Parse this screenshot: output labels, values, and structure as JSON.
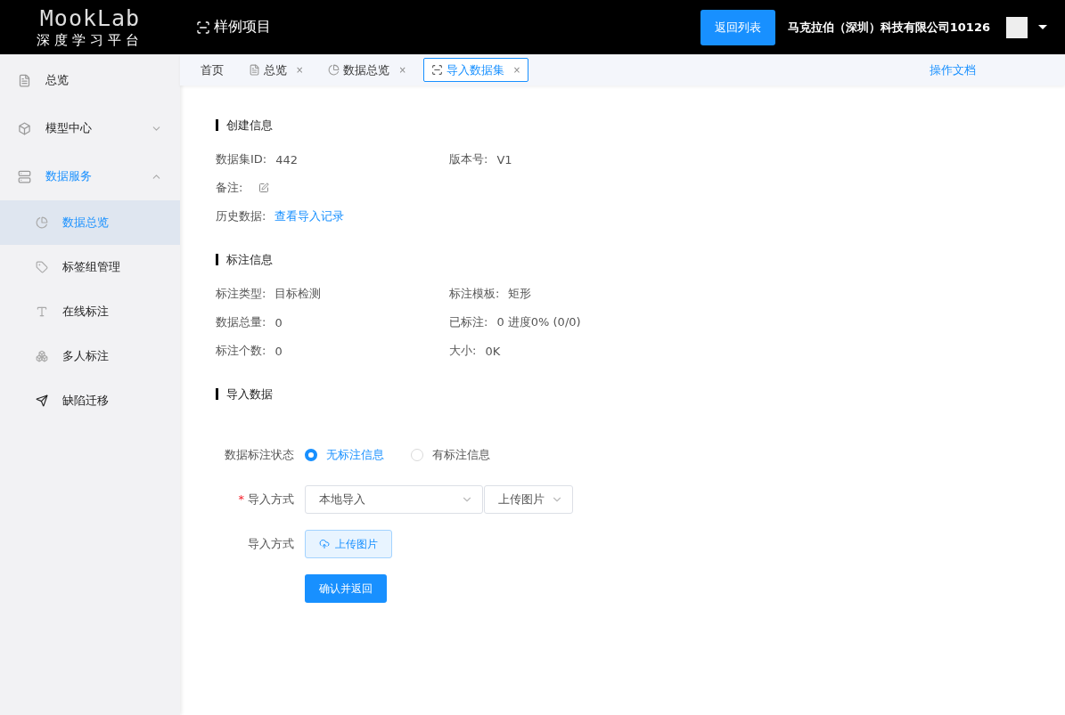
{
  "header": {
    "logo_title": "MookLab",
    "logo_subtitle": "深度学习平台",
    "project": "样例项目",
    "back_button": "返回列表",
    "company": "马克拉伯（深圳）科技有限公司10126"
  },
  "sidebar": {
    "items": [
      {
        "label": "总览",
        "selected": false
      },
      {
        "label": "模型中心",
        "selected": false,
        "expanded": false
      },
      {
        "label": "数据服务",
        "selected": true,
        "expanded": true,
        "children": [
          {
            "label": "数据总览",
            "selected": true
          },
          {
            "label": "标签组管理",
            "selected": false
          },
          {
            "label": "在线标注",
            "selected": false
          },
          {
            "label": "多人标注",
            "selected": false
          },
          {
            "label": "缺陷迁移",
            "selected": false
          }
        ]
      }
    ]
  },
  "tabs": [
    {
      "label": "首页",
      "closable": false,
      "selected": false
    },
    {
      "label": "总览",
      "closable": true,
      "selected": false
    },
    {
      "label": "数据总览",
      "closable": true,
      "selected": false
    },
    {
      "label": "导入数据集",
      "closable": true,
      "selected": true
    }
  ],
  "close_mark": "×",
  "doc_link": "操作文档",
  "sections": [
    {
      "title": "创建信息",
      "rows": [
        [
          {
            "kind": "text",
            "label": "数据集ID:",
            "value": "442"
          },
          {
            "kind": "text",
            "label": "版本号:",
            "value": "V1"
          }
        ],
        [
          {
            "kind": "edit",
            "label": "备注:"
          }
        ],
        [
          {
            "kind": "link",
            "label": "历史数据:",
            "value": "查看导入记录"
          }
        ]
      ]
    },
    {
      "title": "标注信息",
      "rows": [
        [
          {
            "kind": "text",
            "label": "标注类型:",
            "value": "目标检测"
          },
          {
            "kind": "text",
            "label": "标注模板:",
            "value": "矩形"
          }
        ],
        [
          {
            "kind": "text",
            "label": "数据总量:",
            "value": "0"
          },
          {
            "kind": "text",
            "label": "已标注:",
            "value": "0 进度0% (0/0)"
          }
        ],
        [
          {
            "kind": "text",
            "label": "标注个数:",
            "value": "0"
          },
          {
            "kind": "text",
            "label": "大小:",
            "value": "0K"
          }
        ]
      ]
    },
    {
      "title": "导入数据"
    }
  ],
  "form": {
    "status": {
      "label": "数据标注状态",
      "options": [
        {
          "label": "无标注信息",
          "selected": true
        },
        {
          "label": "有标注信息",
          "selected": false
        }
      ]
    },
    "method": {
      "label": "导入方式",
      "required": true,
      "required_mark": "*",
      "select_1": "本地导入",
      "select_2": "上传图片"
    },
    "upload": {
      "label": "导入方式",
      "button": "上传图片"
    },
    "submit": "确认并返回"
  }
}
